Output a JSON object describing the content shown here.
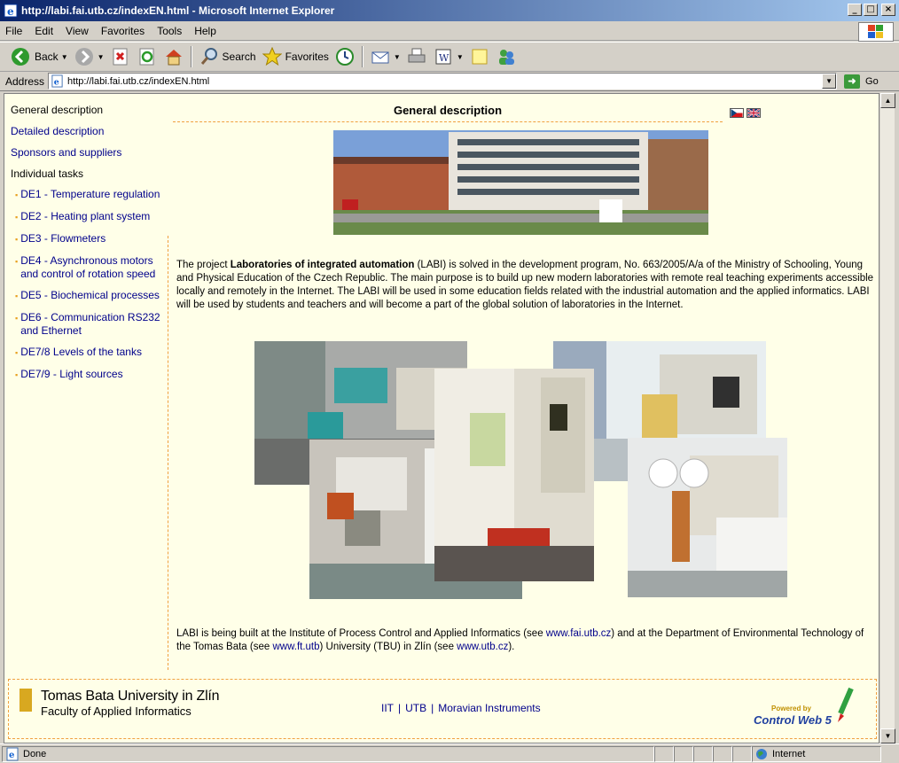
{
  "window": {
    "title": "http://labi.fai.utb.cz/indexEN.html - Microsoft Internet Explorer"
  },
  "menu": [
    "File",
    "Edit",
    "View",
    "Favorites",
    "Tools",
    "Help"
  ],
  "toolbar": {
    "back": "Back",
    "search": "Search",
    "favorites": "Favorites"
  },
  "address": {
    "label": "Address",
    "url": "http://labi.fai.utb.cz/indexEN.html",
    "go": "Go"
  },
  "nav": {
    "general": "General description",
    "detailed": "Detailed description",
    "sponsors": "Sponsors and suppliers",
    "tasks_heading": "Individual tasks",
    "tasks": [
      "DE1 - Temperature regulation",
      "DE2 - Heating plant system",
      "DE3 - Flowmeters",
      "DE4 - Asynchronous motors and control of rotation speed",
      "DE5 - Biochemical processes",
      "DE6 - Communication RS232 and Ethernet",
      "DE7/8 Levels of the tanks",
      "DE7/9 - Light sources"
    ]
  },
  "main": {
    "title": "General description",
    "intro_pre": "The project ",
    "intro_bold": "Laboratories of integrated automation",
    "intro_post": " (LABI) is solved in the development program, No. 663/2005/A/a of the Ministry of Schooling, Young and Physical Education of the Czech Republic. The main purpose is to build up new modern laboratories with remote real teaching experiments accessible locally and remotely in the Internet. The LABI will be used in some education fields related with the industrial automation and the applied informatics. LABI will be used by students and teachers and will become a part of the global solution of laboratories in the Internet.",
    "outro_1": "LABI is being built at the Institute of Process Control and Applied Informatics (see ",
    "outro_link1": "www.fai.utb.cz",
    "outro_2": ") and at the Department of Environmental Technology of the Tomas Bata (see ",
    "outro_link2": "www.ft.utb",
    "outro_3": ") University (TBU) in Zlín (see ",
    "outro_link3": "www.utb.cz",
    "outro_4": ")."
  },
  "footer": {
    "utb_name": "Tomas Bata University in Zlín",
    "utb_faculty": "Faculty of Applied Informatics",
    "links": [
      "IIT",
      "UTB",
      "Moravian Instruments"
    ],
    "powered": "Powered by",
    "cw": "Control Web 5"
  },
  "status": {
    "left": "Done",
    "zone": "Internet"
  }
}
